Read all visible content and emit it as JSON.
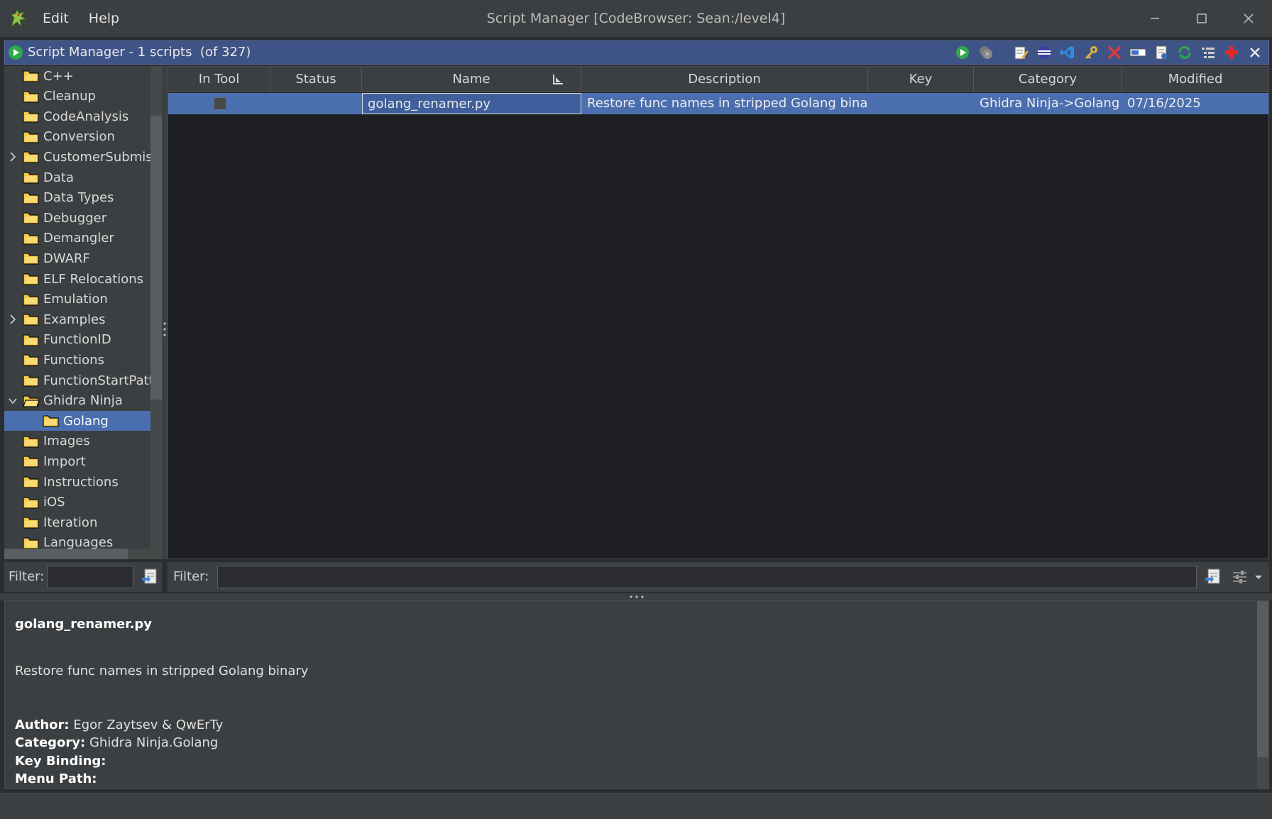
{
  "window": {
    "title": "Script Manager [CodeBrowser: Sean:/level4]",
    "menu": [
      "Edit",
      "Help"
    ]
  },
  "header": {
    "title": "Script Manager - 1 scripts  (of 327)"
  },
  "toolbar": {
    "icons": [
      "run-script-icon",
      "run-last-script-icon",
      "edit-script-icon",
      "eclipse-edit-icon",
      "vscode-edit-icon",
      "key-binding-icon",
      "delete-script-icon",
      "rename-script-icon",
      "new-script-icon",
      "refresh-icon",
      "script-directories-icon",
      "help-icon",
      "close-panel-icon"
    ]
  },
  "tree": {
    "items": [
      {
        "label": "C++",
        "expandable": false,
        "expanded": false
      },
      {
        "label": "Cleanup",
        "expandable": false,
        "expanded": false
      },
      {
        "label": "CodeAnalysis",
        "expandable": false,
        "expanded": false
      },
      {
        "label": "Conversion",
        "expandable": false,
        "expanded": false
      },
      {
        "label": "CustomerSubmiss",
        "expandable": true,
        "expanded": false
      },
      {
        "label": "Data",
        "expandable": false,
        "expanded": false
      },
      {
        "label": "Data Types",
        "expandable": false,
        "expanded": false
      },
      {
        "label": "Debugger",
        "expandable": false,
        "expanded": false
      },
      {
        "label": "Demangler",
        "expandable": false,
        "expanded": false
      },
      {
        "label": "DWARF",
        "expandable": false,
        "expanded": false
      },
      {
        "label": "ELF Relocations",
        "expandable": false,
        "expanded": false
      },
      {
        "label": "Emulation",
        "expandable": false,
        "expanded": false
      },
      {
        "label": "Examples",
        "expandable": true,
        "expanded": false
      },
      {
        "label": "FunctionID",
        "expandable": false,
        "expanded": false
      },
      {
        "label": "Functions",
        "expandable": false,
        "expanded": false
      },
      {
        "label": "FunctionStartPatte",
        "expandable": false,
        "expanded": false
      },
      {
        "label": "Ghidra Ninja",
        "expandable": true,
        "expanded": true
      },
      {
        "label": "Golang",
        "expandable": false,
        "expanded": false,
        "child": true,
        "selected": true
      },
      {
        "label": "Images",
        "expandable": false,
        "expanded": false
      },
      {
        "label": "Import",
        "expandable": false,
        "expanded": false
      },
      {
        "label": "Instructions",
        "expandable": false,
        "expanded": false
      },
      {
        "label": "iOS",
        "expandable": false,
        "expanded": false
      },
      {
        "label": "Iteration",
        "expandable": false,
        "expanded": false
      },
      {
        "label": "Languages",
        "expandable": false,
        "expanded": false
      }
    ]
  },
  "table": {
    "columns": [
      "In Tool",
      "Status",
      "Name",
      "Description",
      "Key",
      "Category",
      "Modified"
    ],
    "rows": [
      {
        "in_tool": false,
        "status": "",
        "name": "golang_renamer.py",
        "description": "Restore func names in stripped Golang binary",
        "key": "",
        "category": "Ghidra Ninja->Golang",
        "modified": "07/16/2025"
      }
    ]
  },
  "filters": {
    "left_label": "Filter:",
    "left_value": "",
    "right_label": "Filter:",
    "right_value": ""
  },
  "details": {
    "name": "golang_renamer.py",
    "description": "Restore func names in stripped Golang binary",
    "author_label": "Author:",
    "author": "Egor Zaytsev & QwErTy",
    "category_label": "Category:",
    "category": "Ghidra Ninja.Golang",
    "keybinding_label": "Key Binding:",
    "keybinding": "",
    "menupath_label": "Menu Path:",
    "menupath": ""
  },
  "colors": {
    "selection": "#4b6eaf",
    "header": "#3f5486",
    "table_bg": "#1e1f22",
    "panel_bg": "#3c3f41"
  }
}
